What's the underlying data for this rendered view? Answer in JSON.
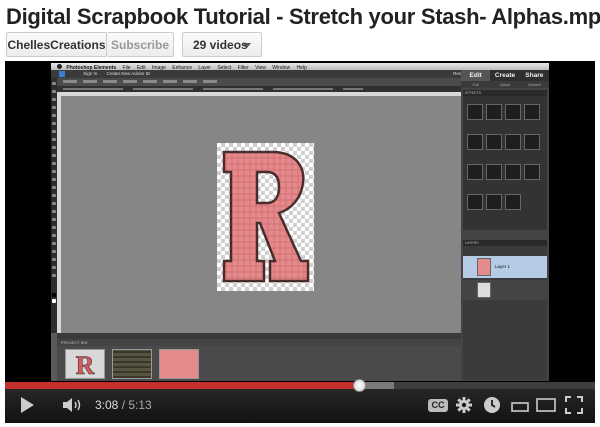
{
  "title": "Digital Scrapbook Tutorial - Stretch your Stash- Alphas.mp4",
  "channel": {
    "name": "ChellesCreations",
    "subscribe_label": "Subscribe",
    "videos_label": "29 videos"
  },
  "video": {
    "app": {
      "app_name": "Photoshop Elements",
      "menu": [
        "File",
        "Edit",
        "Image",
        "Enhance",
        "Layer",
        "Select",
        "Filter",
        "View",
        "Window",
        "Help"
      ],
      "sign_in": "Sign In",
      "create_account": "Create New Adobe ID",
      "reset_panels": "Reset Panels",
      "undo": "Undo",
      "redo": "Redo",
      "organizer": "Organizer",
      "panel_tabs": [
        "Edit",
        "Create",
        "Share"
      ],
      "panel_subtabs": [
        "Full",
        "Quick",
        "Guided"
      ],
      "effects_header": "EFFECTS",
      "layers_header": "LAYERS",
      "layer_name": "Layer 1",
      "project_bin": "PROJECT BIN",
      "zoom_status": "66.67%",
      "letter": "R"
    }
  },
  "player": {
    "current_time": "3:08",
    "separator": " / ",
    "total_time": "5:13",
    "progress": 0.6,
    "buffered": 0.66,
    "cc_label": "CC",
    "colors": {
      "progress": "#c4302b",
      "letter_fill": "#e58a8c",
      "letter_outline": "#4a2c2c"
    }
  }
}
